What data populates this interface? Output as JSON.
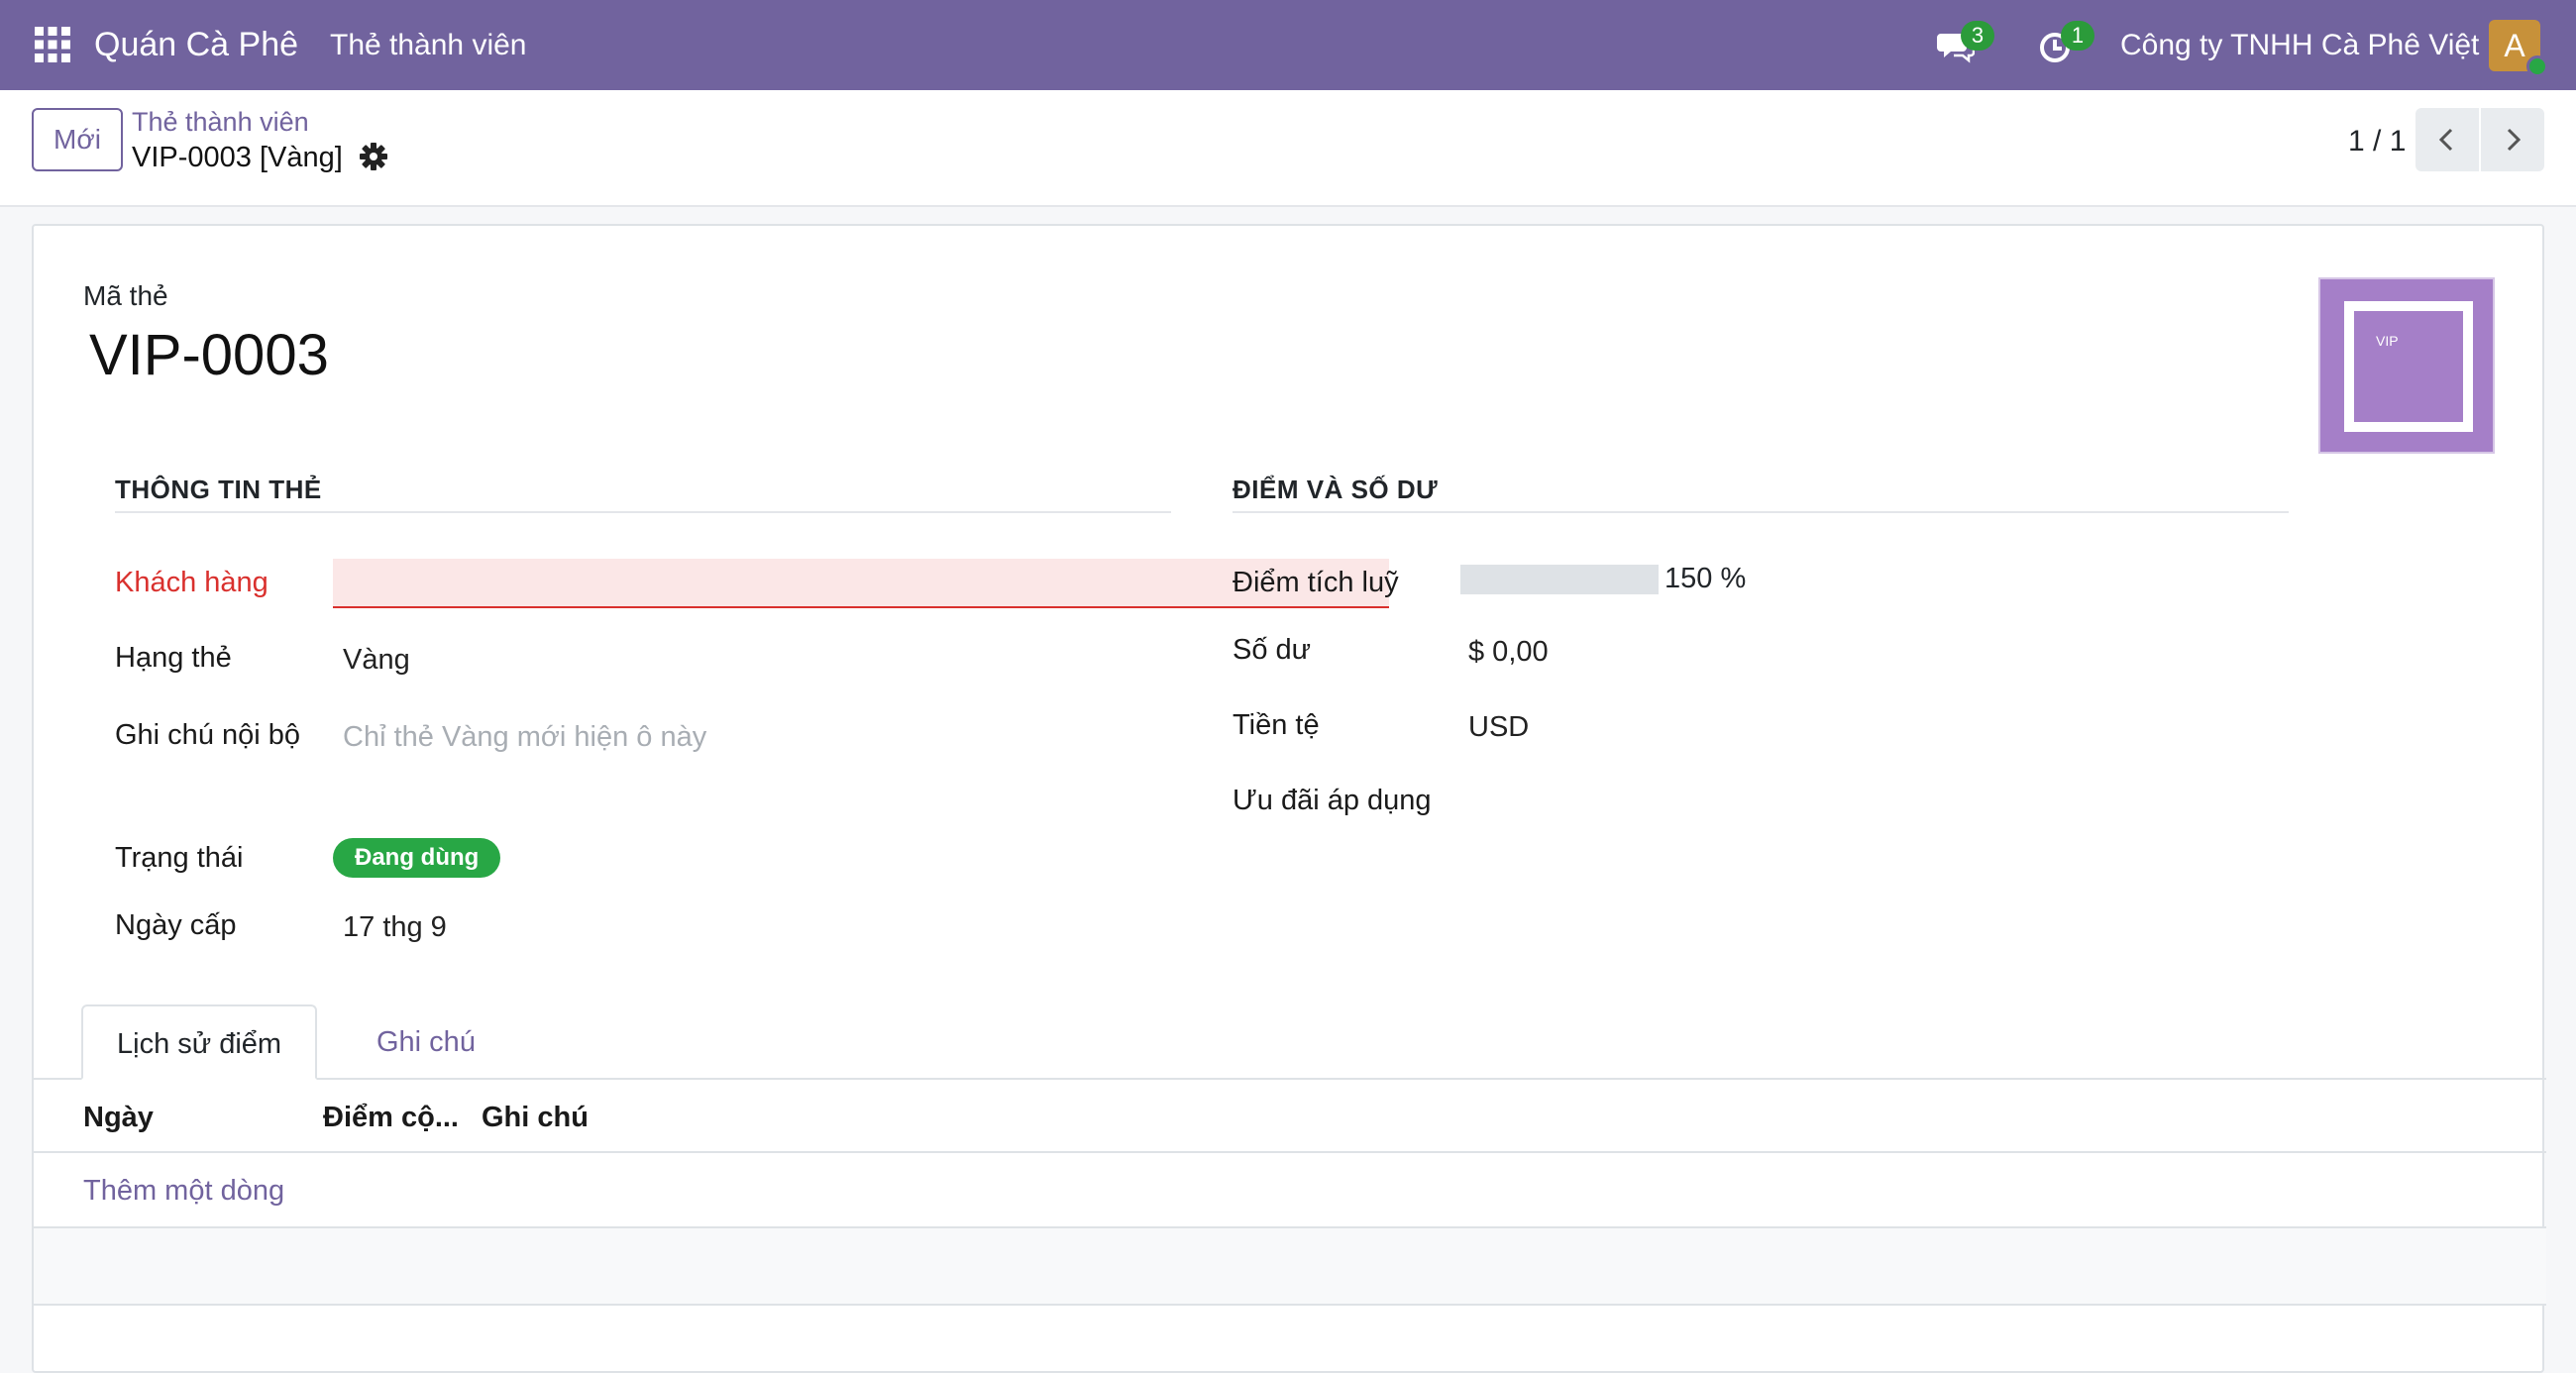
{
  "navbar": {
    "app_name": "Quán Cà Phê",
    "menu_item": "Thẻ thành viên",
    "messages_count": "3",
    "activities_count": "1",
    "company": "Công ty TNHH Cà Phê Việt",
    "avatar_letter": "A",
    "accent_color": "#71639e"
  },
  "control_panel": {
    "new_button": "Mới",
    "breadcrumb_parent": "Thẻ thành viên",
    "breadcrumb_current": "VIP-0003 [Vàng]",
    "pager_value": "1 / 1"
  },
  "form": {
    "code_label": "Mã thẻ",
    "code_value": "VIP-0003",
    "image_text": "VIP",
    "card_info": {
      "title": "THÔNG TIN THẺ",
      "customer_label": "Khách hàng",
      "customer_value": "",
      "tier_label": "Hạng thẻ",
      "tier_value": "Vàng",
      "note_label": "Ghi chú nội bộ",
      "note_placeholder": "Chỉ thẻ Vàng mới hiện ô này",
      "status_label": "Trạng thái",
      "status_value": "Đang dùng",
      "issue_date_label": "Ngày cấp",
      "issue_date_value": "17 thg 9"
    },
    "points_balance": {
      "title": "ĐIỂM VÀ SỐ DƯ",
      "points_label": "Điểm tích luỹ",
      "points_progress_percent": 0,
      "points_value_text": "150 %",
      "balance_label": "Số dư",
      "balance_value": "$ 0,00",
      "currency_label": "Tiền tệ",
      "currency_value": "USD",
      "offers_label": "Ưu đãi áp dụng",
      "offers_value": ""
    }
  },
  "notebook": {
    "tabs": [
      "Lịch sử điểm",
      "Ghi chú"
    ],
    "active_tab": 0,
    "columns": [
      "Ngày",
      "Điểm cộ...",
      "Ghi chú"
    ],
    "add_line": "Thêm một dòng"
  }
}
